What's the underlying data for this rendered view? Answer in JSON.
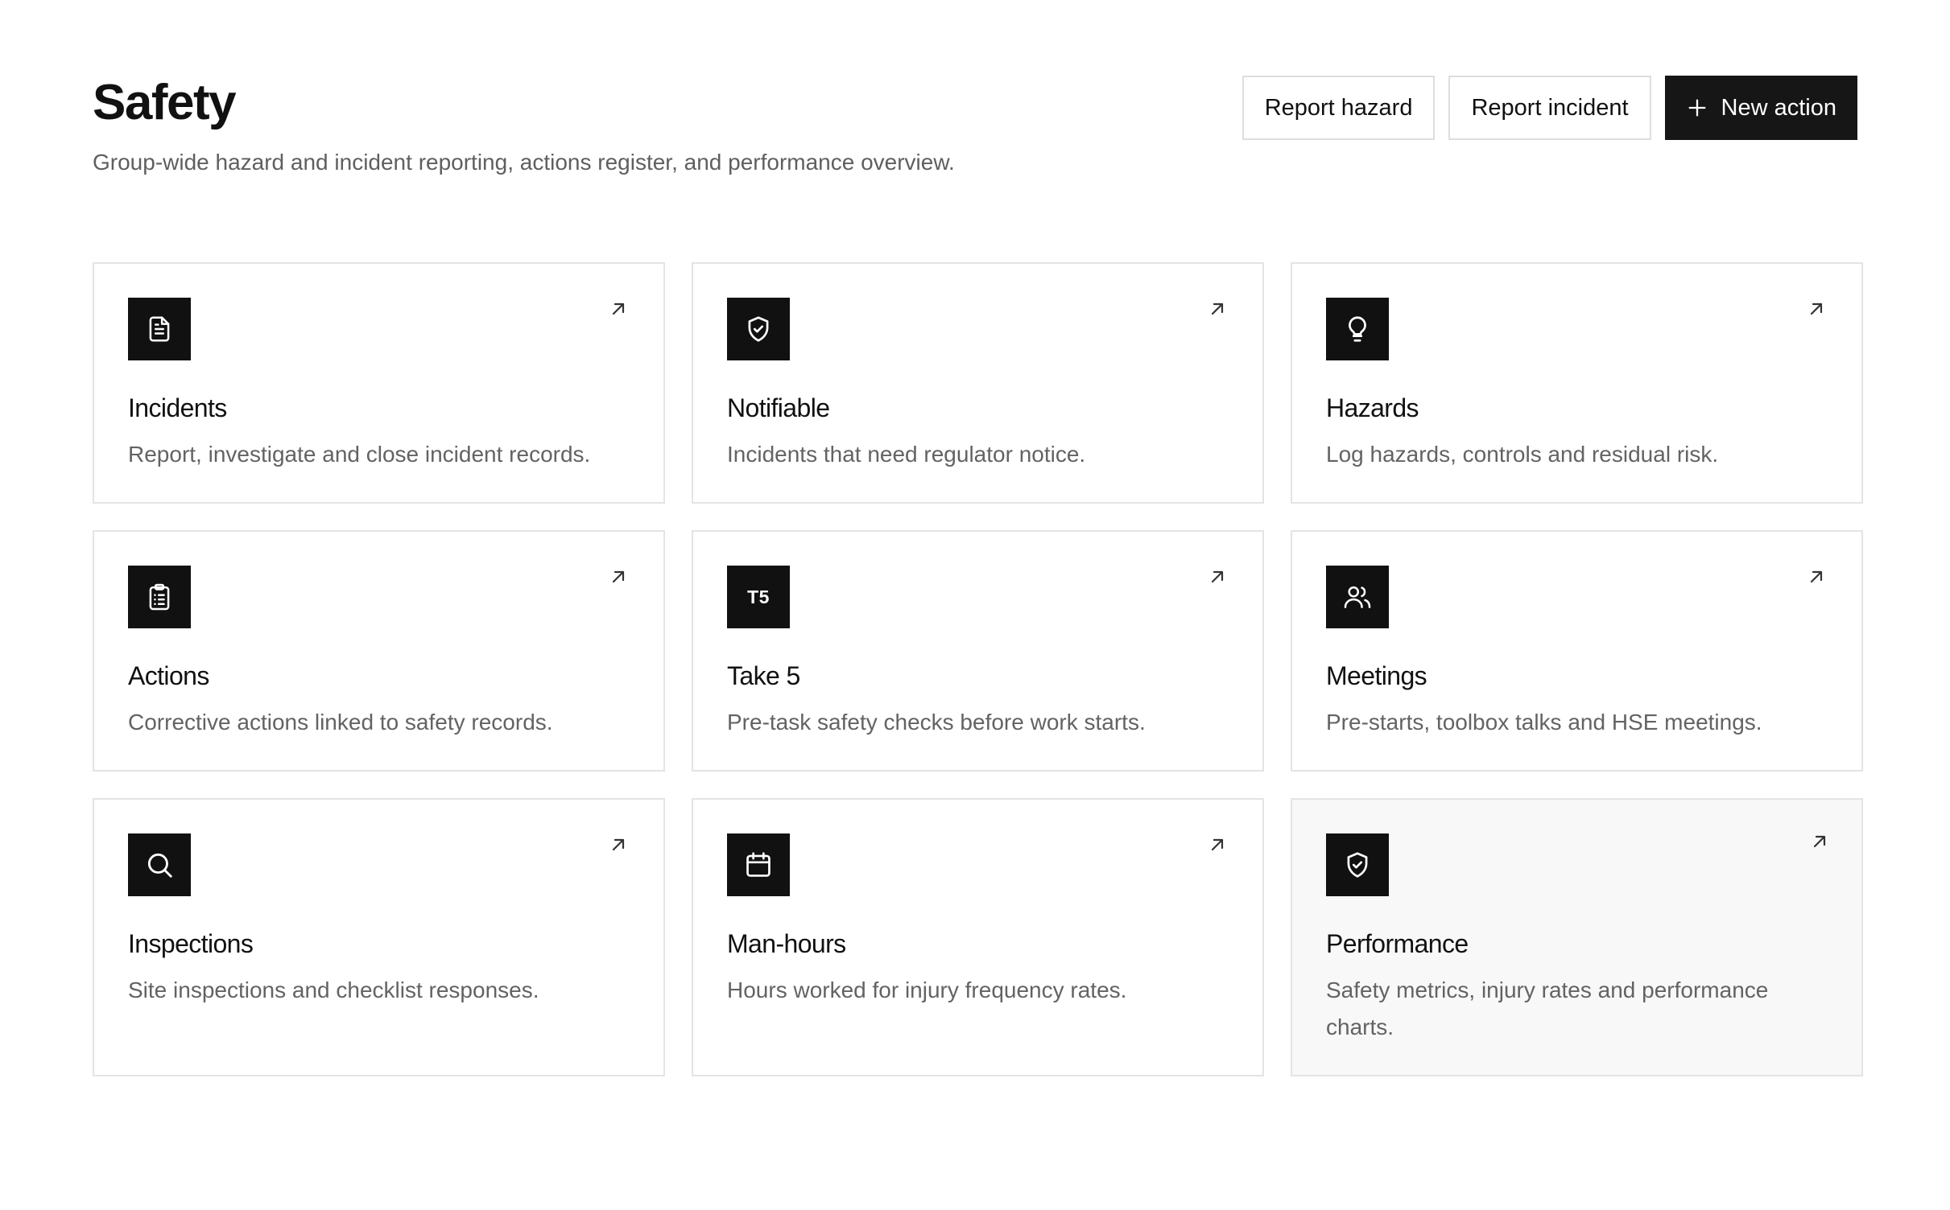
{
  "header": {
    "title": "Safety",
    "subtitle": "Group-wide hazard and incident reporting, actions register, and performance overview.",
    "actions": {
      "report_hazard": "Report hazard",
      "report_incident": "Report incident",
      "new_action": "New action"
    }
  },
  "cards": [
    {
      "title": "Incidents",
      "description": "Report, investigate and close incident records.",
      "icon": "document-icon"
    },
    {
      "title": "Notifiable",
      "description": "Incidents that need regulator notice.",
      "icon": "shield-check-icon"
    },
    {
      "title": "Hazards",
      "description": "Log hazards, controls and residual risk.",
      "icon": "lightbulb-icon"
    },
    {
      "title": "Actions",
      "description": "Corrective actions linked to safety records.",
      "icon": "clipboard-list-icon"
    },
    {
      "title": "Take 5",
      "description": "Pre-task safety checks before work starts.",
      "icon": "t5-badge",
      "badge": "T5"
    },
    {
      "title": "Meetings",
      "description": "Pre-starts, toolbox talks and HSE meetings.",
      "icon": "users-icon"
    },
    {
      "title": "Inspections",
      "description": "Site inspections and checklist responses.",
      "icon": "search-icon"
    },
    {
      "title": "Man-hours",
      "description": "Hours worked for injury frequency rates.",
      "icon": "calendar-icon"
    },
    {
      "title": "Performance",
      "description": "Safety metrics, injury rates and performance charts.",
      "icon": "shield-check-icon"
    }
  ],
  "colors": {
    "primary": "#161616",
    "icon_tile": "#111111",
    "border": "#e4e4e4",
    "muted_text": "#636363",
    "hover_card": "#f8f8f8"
  }
}
